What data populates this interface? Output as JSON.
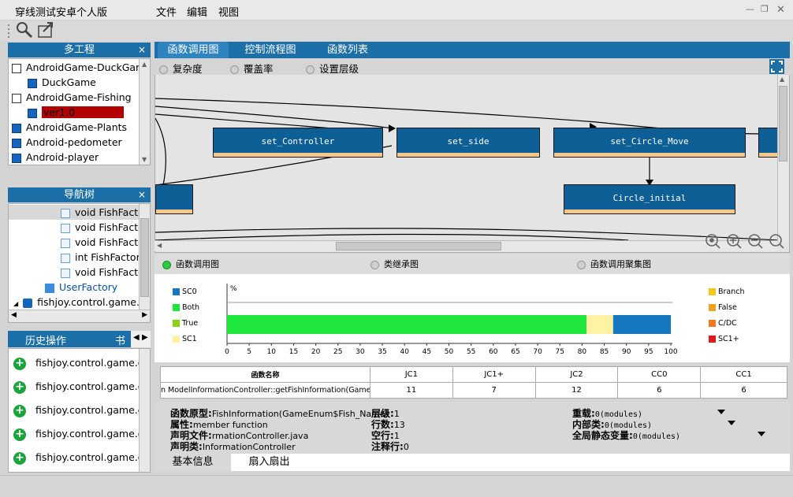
{
  "app_title": "穿线测试安卓个人版",
  "menu": [
    "文件",
    "编辑",
    "视图"
  ],
  "projects_panel": {
    "title": "多工程",
    "close": "×",
    "items": [
      {
        "label": "AndroidGame-DuckGame",
        "level": 0,
        "icon": "project-icon"
      },
      {
        "label": "DuckGame",
        "level": 1,
        "icon": "link-icon"
      },
      {
        "label": "AndroidGame-Fishing",
        "level": 0,
        "icon": "project-icon"
      },
      {
        "label": "ver1.0",
        "level": 1,
        "icon": "link-icon",
        "selected": true
      },
      {
        "label": "AndroidGame-Plants",
        "level": 0,
        "icon": "link-icon"
      },
      {
        "label": "Android-pedometer",
        "level": 0,
        "icon": "link-icon"
      },
      {
        "label": "Android-player",
        "level": 0,
        "icon": "link-icon"
      }
    ]
  },
  "nav_panel": {
    "title": "导航树",
    "close": "×",
    "items": [
      {
        "label": "void FishFacto",
        "icon": "file-icon"
      },
      {
        "label": "void FishFacto",
        "icon": "file-icon"
      },
      {
        "label": "void FishFacto",
        "icon": "file-icon"
      },
      {
        "label": "int FishFactory",
        "icon": "file-icon"
      },
      {
        "label": "void FishFacto",
        "icon": "file-icon"
      },
      {
        "label": "UserFactory",
        "icon": "class-icon"
      },
      {
        "label": "fishjoy.control.game.",
        "icon": "package-icon"
      }
    ]
  },
  "history_panel": {
    "tabs": [
      "历史操作",
      "书"
    ],
    "items": [
      "fishjoy.control.game.o",
      "fishjoy.control.game.o",
      "fishjoy.control.game.o",
      "fishjoy.control.game.o",
      "fishjoy.control.game.o"
    ]
  },
  "main_tabs": [
    "函数调用图",
    "控制流程图",
    "函数列表"
  ],
  "graph_options": [
    "复杂度",
    "覆盖率",
    "设置层级"
  ],
  "graph_nodes": [
    "set_Controller",
    "set_side",
    "set_Circle_Move",
    "Circle_initial"
  ],
  "bottom_radios": [
    "函数调用图",
    "类继承图",
    "函数调用聚集图"
  ],
  "chart_data": {
    "type": "bar",
    "ylabel": "%",
    "xlim": [
      0,
      100
    ],
    "ticks": [
      0,
      5,
      10,
      15,
      20,
      25,
      30,
      35,
      40,
      45,
      50,
      55,
      60,
      65,
      70,
      75,
      80,
      85,
      90,
      95,
      100
    ],
    "series": [
      {
        "name": "Both",
        "start": 0,
        "end": 81,
        "color": "#1ee63c"
      },
      {
        "name": "SC1",
        "start": 81,
        "end": 87,
        "color": "#fdf3a2"
      },
      {
        "name": "SC0",
        "start": 87,
        "end": 101,
        "color": "#1477c0"
      }
    ],
    "legend_left": [
      {
        "name": "SC0",
        "color": "#1477c0"
      },
      {
        "name": "Both",
        "color": "#1ee63c"
      },
      {
        "name": "True",
        "color": "#8ad21a"
      },
      {
        "name": "SC1",
        "color": "#fdf3a2"
      }
    ],
    "legend_right": [
      {
        "name": "Branch",
        "color": "#f5c61a"
      },
      {
        "name": "False",
        "color": "#f0a020"
      },
      {
        "name": "C/DC",
        "color": "#f07a20"
      },
      {
        "name": "SC1+",
        "color": "#e01818"
      }
    ]
  },
  "metrics_table": {
    "headers": [
      "函数名称",
      "JC1",
      "JC1+",
      "JC2",
      "CC0",
      "CC1"
    ],
    "row": [
      "n ModelInformationController::getFishInformation(GameEn",
      "11",
      "7",
      "12",
      "6",
      "6"
    ]
  },
  "info": {
    "proto_label": "函数原型:",
    "proto_val": "FishInformation(GameEnum$Fish_Name)",
    "level_label": "层级:",
    "level_val": "1",
    "attr_label": "属性:",
    "attr_val": "member function",
    "lines_label": "行数:",
    "lines_val": "13",
    "file_label": "声明文件:",
    "file_val": "rmationController.java",
    "blank_label": "空行:",
    "blank_val": "1",
    "class_label": "声明类:",
    "class_val": "InformationController",
    "comment_label": "注释行:",
    "comment_val": "0",
    "overload_label": "重载:",
    "overload_val": "0(modules)",
    "inner_label": "内部类:",
    "inner_val": "0(modules)",
    "global_label": "全局静态变量:",
    "global_val": "0(modules)"
  },
  "bottom_tabs": [
    "基本信息",
    "扇入扇出"
  ]
}
